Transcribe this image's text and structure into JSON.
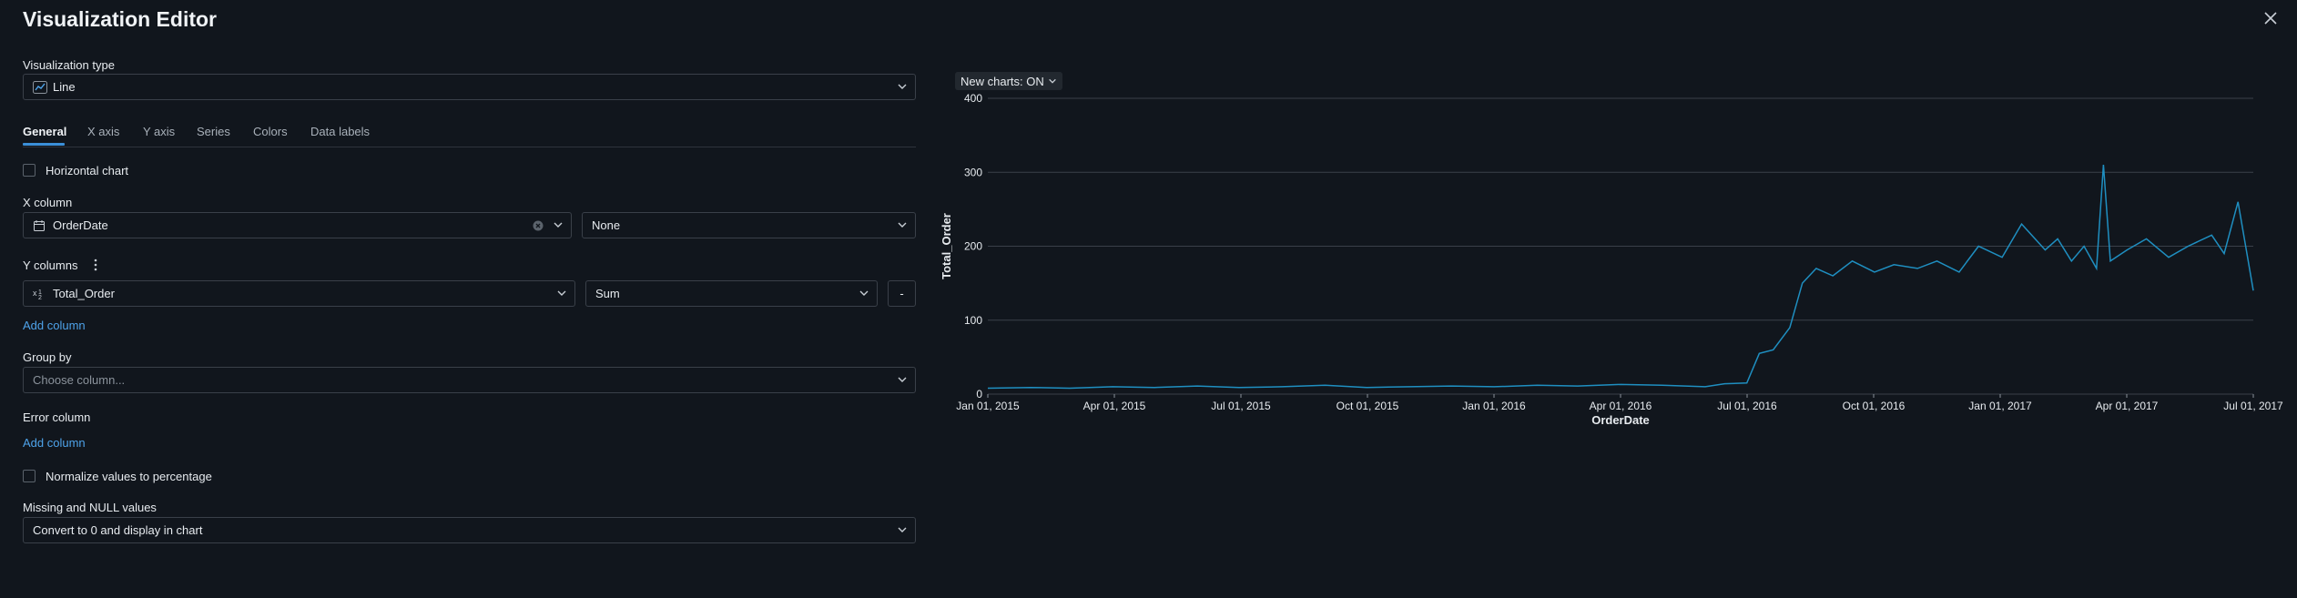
{
  "header": {
    "title": "Visualization Editor",
    "close_icon": "close-icon"
  },
  "viz_type": {
    "label": "Visualization type",
    "value": "Line",
    "icon": "line-chart-icon"
  },
  "tabs": [
    "General",
    "X axis",
    "Y axis",
    "Series",
    "Colors",
    "Data labels"
  ],
  "active_tab": "General",
  "horizontal_chart": {
    "label": "Horizontal chart",
    "checked": false
  },
  "x_column": {
    "label": "X column",
    "value": "OrderDate",
    "icon": "calendar-icon",
    "scale": "None"
  },
  "y_columns": {
    "label": "Y columns",
    "value": "Total_Order",
    "icon": "numeric-column-icon",
    "aggregation": "Sum",
    "remove_label": "-",
    "add_label": "Add column"
  },
  "group_by": {
    "label": "Group by",
    "placeholder": "Choose column..."
  },
  "error_column": {
    "label": "Error column",
    "add_label": "Add column"
  },
  "normalize": {
    "label": "Normalize values to percentage",
    "checked": false
  },
  "missing_values": {
    "label": "Missing and NULL values",
    "value": "Convert to 0 and display in chart"
  },
  "new_charts_toggle": "New charts: ON",
  "colors": {
    "series": "#1f8fc1",
    "grid": "#3a4049",
    "link": "#4ea3ea"
  },
  "chart_data": {
    "type": "line",
    "xlabel": "OrderDate",
    "ylabel": "Total_Order",
    "xlim": [
      "2015-01-01",
      "2017-07-01"
    ],
    "ylim": [
      0,
      400
    ],
    "y_ticks": [
      0,
      100,
      200,
      300,
      400
    ],
    "x_ticks": [
      "Jan 01, 2015",
      "Apr 01, 2015",
      "Jul 01, 2015",
      "Oct 01, 2015",
      "Jan 01, 2016",
      "Apr 01, 2016",
      "Jul 01, 2016",
      "Oct 01, 2016",
      "Jan 01, 2017",
      "Apr 01, 2017",
      "Jul 01, 2017"
    ],
    "grid": true,
    "series": [
      {
        "x": [
          "2015-01-01",
          "2015-02-01",
          "2015-03-01",
          "2015-04-01",
          "2015-05-01",
          "2015-06-01",
          "2015-07-01",
          "2015-08-01",
          "2015-09-01",
          "2015-10-01",
          "2015-11-01",
          "2015-12-01",
          "2016-01-01",
          "2016-02-01",
          "2016-03-01",
          "2016-04-01",
          "2016-05-01",
          "2016-06-01",
          "2016-06-15",
          "2016-07-01",
          "2016-07-10",
          "2016-07-20",
          "2016-08-01",
          "2016-08-10",
          "2016-08-20",
          "2016-09-01",
          "2016-09-15",
          "2016-10-01",
          "2016-10-15",
          "2016-11-01",
          "2016-11-15",
          "2016-12-01",
          "2016-12-15",
          "2017-01-01",
          "2017-01-15",
          "2017-02-01",
          "2017-02-10",
          "2017-02-20",
          "2017-03-01",
          "2017-03-10",
          "2017-03-15",
          "2017-03-20",
          "2017-04-01",
          "2017-04-15",
          "2017-05-01",
          "2017-05-15",
          "2017-06-01",
          "2017-06-10",
          "2017-06-20",
          "2017-06-25",
          "2017-07-01"
        ],
        "y": [
          8,
          9,
          8,
          10,
          9,
          11,
          9,
          10,
          12,
          9,
          10,
          11,
          10,
          12,
          11,
          13,
          12,
          10,
          14,
          15,
          55,
          60,
          90,
          150,
          170,
          160,
          180,
          165,
          175,
          170,
          180,
          165,
          200,
          185,
          230,
          195,
          210,
          180,
          200,
          170,
          310,
          180,
          195,
          210,
          185,
          200,
          215,
          190,
          260,
          205,
          140
        ]
      }
    ]
  }
}
